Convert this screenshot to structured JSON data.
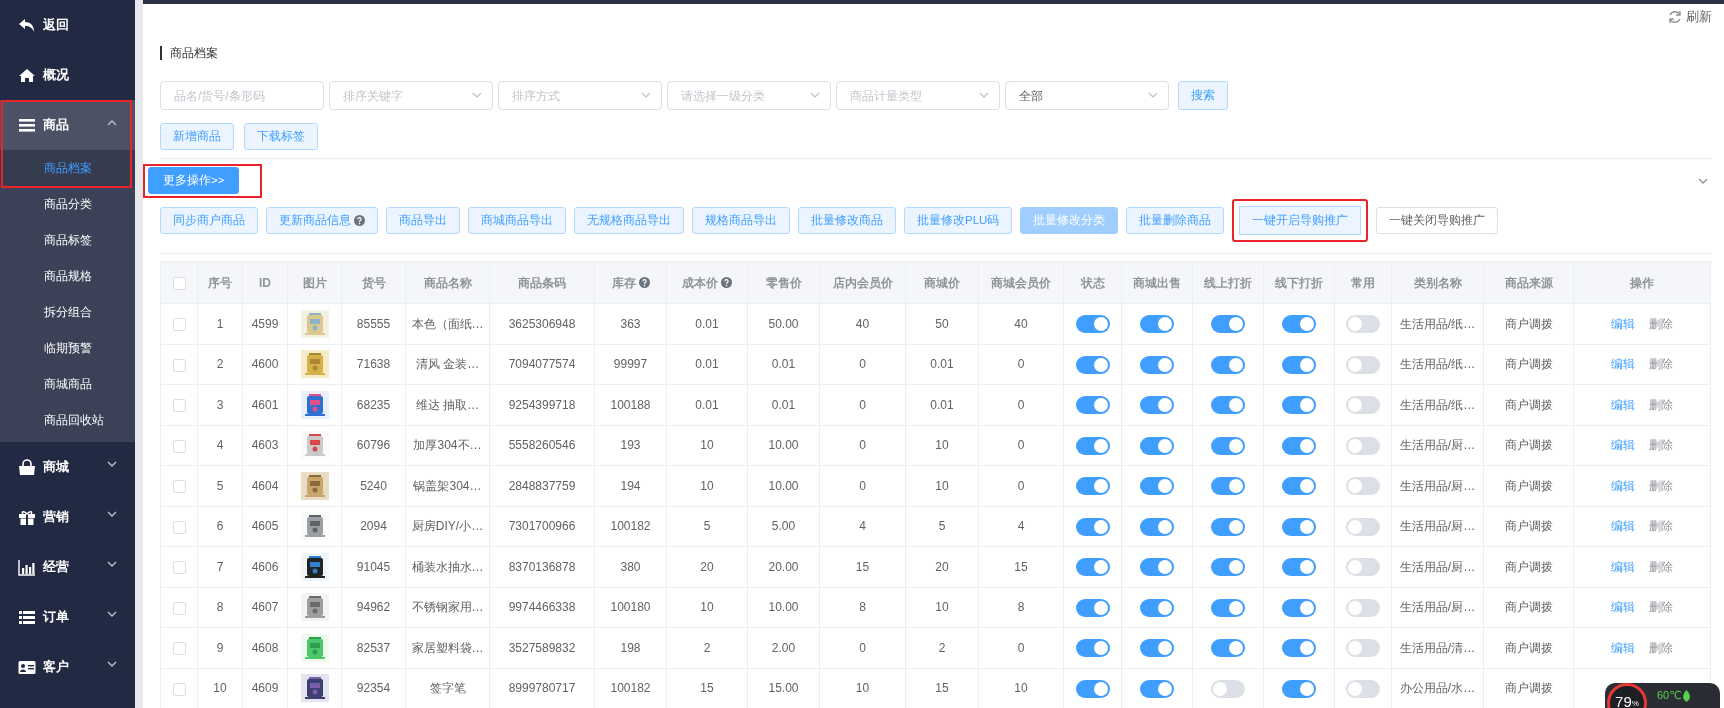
{
  "sidebar": {
    "items": [
      {
        "label": "返回"
      },
      {
        "label": "概况"
      },
      {
        "label": "商品",
        "expanded": true,
        "highlighted": true,
        "children": [
          {
            "label": "商品档案",
            "selected": true
          },
          {
            "label": "商品分类",
            "selected": false
          },
          {
            "label": "商品标签",
            "selected": false
          },
          {
            "label": "商品规格",
            "selected": false
          },
          {
            "label": "拆分组合",
            "selected": false
          },
          {
            "label": "临期预警",
            "selected": false
          },
          {
            "label": "商城商品",
            "selected": false
          },
          {
            "label": "商品回收站",
            "selected": false
          }
        ]
      },
      {
        "label": "商城",
        "expanded": false
      },
      {
        "label": "营销",
        "expanded": false
      },
      {
        "label": "经营",
        "expanded": false
      },
      {
        "label": "订单",
        "expanded": false
      },
      {
        "label": "客户",
        "expanded": false
      }
    ]
  },
  "refresh": "刷新",
  "page_title": "商品档案",
  "filters": [
    {
      "kind": "input",
      "placeholder": "品名/货号/条形码"
    },
    {
      "kind": "select",
      "placeholder": "排序关键字"
    },
    {
      "kind": "select",
      "placeholder": "排序方式"
    },
    {
      "kind": "select",
      "placeholder": "请选择一级分类"
    },
    {
      "kind": "select",
      "placeholder": "商品计量类型"
    },
    {
      "kind": "select",
      "value": "全部"
    }
  ],
  "search_button": "搜索",
  "actions": [
    "新增商品",
    "下载标签"
  ],
  "more_button": {
    "label": "更多操作>>",
    "highlighted": true
  },
  "batch_buttons": [
    {
      "label": "同步商户商品",
      "kind": "light",
      "disabled": false,
      "highlighted": false,
      "help": false
    },
    {
      "label": "更新商品信息",
      "kind": "light",
      "disabled": false,
      "highlighted": false,
      "help": true
    },
    {
      "label": "商品导出",
      "kind": "light",
      "disabled": false,
      "highlighted": false,
      "help": false
    },
    {
      "label": "商城商品导出",
      "kind": "light",
      "disabled": false,
      "highlighted": false,
      "help": false
    },
    {
      "label": "无规格商品导出",
      "kind": "light",
      "disabled": false,
      "highlighted": false,
      "help": false
    },
    {
      "label": "规格商品导出",
      "kind": "light",
      "disabled": false,
      "highlighted": false,
      "help": false
    },
    {
      "label": "批量修改商品",
      "kind": "light",
      "disabled": false,
      "highlighted": false,
      "help": false
    },
    {
      "label": "批量修改PLU码",
      "kind": "light",
      "disabled": false,
      "highlighted": false,
      "help": false
    },
    {
      "label": "批量修改分类",
      "kind": "light",
      "disabled": true,
      "highlighted": false,
      "help": false
    },
    {
      "label": "批量删除商品",
      "kind": "light",
      "disabled": false,
      "highlighted": false,
      "help": false
    },
    {
      "label": "一键开启导购推广",
      "kind": "light",
      "disabled": false,
      "highlighted": true,
      "help": false
    },
    {
      "label": "一键关闭导购推广",
      "kind": "plain",
      "disabled": false,
      "highlighted": false,
      "help": false
    }
  ],
  "table": {
    "select_all": {
      "checked": false
    },
    "columns": [
      {
        "label": "序号",
        "help": false
      },
      {
        "label": "ID",
        "help": false
      },
      {
        "label": "图片",
        "help": false
      },
      {
        "label": "货号",
        "help": false
      },
      {
        "label": "商品名称",
        "help": false
      },
      {
        "label": "商品条码",
        "help": false
      },
      {
        "label": "库存",
        "help": true
      },
      {
        "label": "成本价",
        "help": true
      },
      {
        "label": "零售价",
        "help": false
      },
      {
        "label": "店内会员价",
        "help": false
      },
      {
        "label": "商城价",
        "help": false
      },
      {
        "label": "商城会员价",
        "help": false
      },
      {
        "label": "状态",
        "help": false
      },
      {
        "label": "商城出售",
        "help": false
      },
      {
        "label": "线上打折",
        "help": false
      },
      {
        "label": "线下打折",
        "help": false
      },
      {
        "label": "常用",
        "help": false
      },
      {
        "label": "类别名称",
        "help": false
      },
      {
        "label": "商品来源",
        "help": false
      },
      {
        "label": "操作",
        "help": false
      }
    ],
    "rows": [
      {
        "checked": false,
        "index": "1",
        "id": "4599",
        "sku": "85555",
        "name": "本色（面纸…",
        "barcode": "3625306948",
        "stock": "363",
        "cost": "0.01",
        "retail": "50.00",
        "store_member_price": "40",
        "mall_price": "50",
        "mall_member_price": "40",
        "status": true,
        "mall_sale": true,
        "online_discount": true,
        "offline_discount": true,
        "common": false,
        "category": "生活用品/纸…",
        "source": "商户调拨",
        "actions": [
          "编辑",
          "删除"
        ]
      },
      {
        "checked": false,
        "index": "2",
        "id": "4600",
        "sku": "71638",
        "name": "清风 金装…",
        "barcode": "7094077574",
        "stock": "99997",
        "cost": "0.01",
        "retail": "0.01",
        "store_member_price": "0",
        "mall_price": "0.01",
        "mall_member_price": "0",
        "status": true,
        "mall_sale": true,
        "online_discount": true,
        "offline_discount": true,
        "common": false,
        "category": "生活用品/纸…",
        "source": "商户调拨",
        "actions": [
          "编辑",
          "删除"
        ]
      },
      {
        "checked": false,
        "index": "3",
        "id": "4601",
        "sku": "68235",
        "name": "维达 抽取…",
        "barcode": "9254399718",
        "stock": "100188",
        "cost": "0.01",
        "retail": "0.01",
        "store_member_price": "0",
        "mall_price": "0.01",
        "mall_member_price": "0",
        "status": true,
        "mall_sale": true,
        "online_discount": true,
        "offline_discount": true,
        "common": false,
        "category": "生活用品/纸…",
        "source": "商户调拨",
        "actions": [
          "编辑",
          "删除"
        ]
      },
      {
        "checked": false,
        "index": "4",
        "id": "4603",
        "sku": "60796",
        "name": "加厚304不…",
        "barcode": "5558260546",
        "stock": "193",
        "cost": "10",
        "retail": "10.00",
        "store_member_price": "0",
        "mall_price": "10",
        "mall_member_price": "0",
        "status": true,
        "mall_sale": true,
        "online_discount": true,
        "offline_discount": true,
        "common": false,
        "category": "生活用品/厨…",
        "source": "商户调拨",
        "actions": [
          "编辑",
          "删除"
        ]
      },
      {
        "checked": false,
        "index": "5",
        "id": "4604",
        "sku": "5240",
        "name": "锅盖架304…",
        "barcode": "2848837759",
        "stock": "194",
        "cost": "10",
        "retail": "10.00",
        "store_member_price": "0",
        "mall_price": "10",
        "mall_member_price": "0",
        "status": true,
        "mall_sale": true,
        "online_discount": true,
        "offline_discount": true,
        "common": false,
        "category": "生活用品/厨…",
        "source": "商户调拨",
        "actions": [
          "编辑",
          "删除"
        ]
      },
      {
        "checked": false,
        "index": "6",
        "id": "4605",
        "sku": "2094",
        "name": "厨房DIY/小…",
        "barcode": "7301700966",
        "stock": "100182",
        "cost": "5",
        "retail": "5.00",
        "store_member_price": "4",
        "mall_price": "5",
        "mall_member_price": "4",
        "status": true,
        "mall_sale": true,
        "online_discount": true,
        "offline_discount": true,
        "common": false,
        "category": "生活用品/厨…",
        "source": "商户调拨",
        "actions": [
          "编辑",
          "删除"
        ]
      },
      {
        "checked": false,
        "index": "7",
        "id": "4606",
        "sku": "91045",
        "name": "桶装水抽水…",
        "barcode": "8370136878",
        "stock": "380",
        "cost": "20",
        "retail": "20.00",
        "store_member_price": "15",
        "mall_price": "20",
        "mall_member_price": "15",
        "status": true,
        "mall_sale": true,
        "online_discount": true,
        "offline_discount": true,
        "common": false,
        "category": "生活用品/厨…",
        "source": "商户调拨",
        "actions": [
          "编辑",
          "删除"
        ]
      },
      {
        "checked": false,
        "index": "8",
        "id": "4607",
        "sku": "94962",
        "name": "不锈钢家用…",
        "barcode": "9974466338",
        "stock": "100180",
        "cost": "10",
        "retail": "10.00",
        "store_member_price": "8",
        "mall_price": "10",
        "mall_member_price": "8",
        "status": true,
        "mall_sale": true,
        "online_discount": true,
        "offline_discount": true,
        "common": false,
        "category": "生活用品/厨…",
        "source": "商户调拨",
        "actions": [
          "编辑",
          "删除"
        ]
      },
      {
        "checked": false,
        "index": "9",
        "id": "4608",
        "sku": "82537",
        "name": "家居塑料袋…",
        "barcode": "3527589832",
        "stock": "198",
        "cost": "2",
        "retail": "2.00",
        "store_member_price": "0",
        "mall_price": "2",
        "mall_member_price": "0",
        "status": true,
        "mall_sale": true,
        "online_discount": true,
        "offline_discount": true,
        "common": false,
        "category": "生活用品/清…",
        "source": "商户调拨",
        "actions": [
          "编辑",
          "删除"
        ]
      },
      {
        "checked": false,
        "index": "10",
        "id": "4609",
        "sku": "92354",
        "name": "签字笔",
        "barcode": "8999780717",
        "stock": "100182",
        "cost": "15",
        "retail": "15.00",
        "store_member_price": "10",
        "mall_price": "15",
        "mall_member_price": "10",
        "status": true,
        "mall_sale": true,
        "online_discount": false,
        "offline_discount": true,
        "common": false,
        "category": "办公用品/水…",
        "source": "商户调拨"
      }
    ]
  },
  "monitor": {
    "load": "79",
    "unit": "%",
    "temperature": "60℃"
  }
}
